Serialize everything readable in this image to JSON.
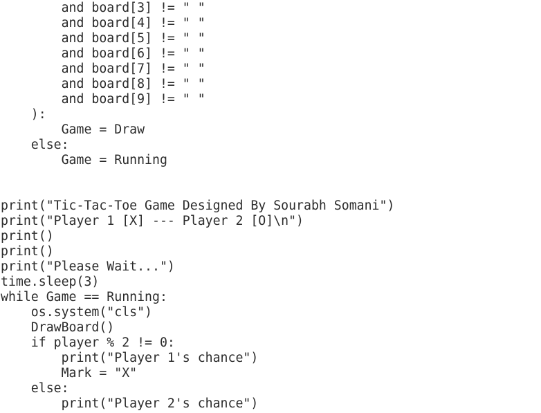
{
  "editor": {
    "lines": [
      "        and board[3] != \" \"",
      "        and board[4] != \" \"",
      "        and board[5] != \" \"",
      "        and board[6] != \" \"",
      "        and board[7] != \" \"",
      "        and board[8] != \" \"",
      "        and board[9] != \" \"",
      "    ):",
      "        Game = Draw",
      "    else:",
      "        Game = Running",
      "",
      "",
      "print(\"Tic-Tac-Toe Game Designed By Sourabh Somani\")",
      "print(\"Player 1 [X] --- Player 2 [O]\\n\")",
      "print()",
      "print()",
      "print(\"Please Wait...\")",
      "time.sleep(3)",
      "while Game == Running:",
      "    os.system(\"cls\")",
      "    DrawBoard()",
      "    if player % 2 != 0:",
      "        print(\"Player 1's chance\")",
      "        Mark = \"X\"",
      "    else:",
      "        print(\"Player 2's chance\")"
    ]
  }
}
